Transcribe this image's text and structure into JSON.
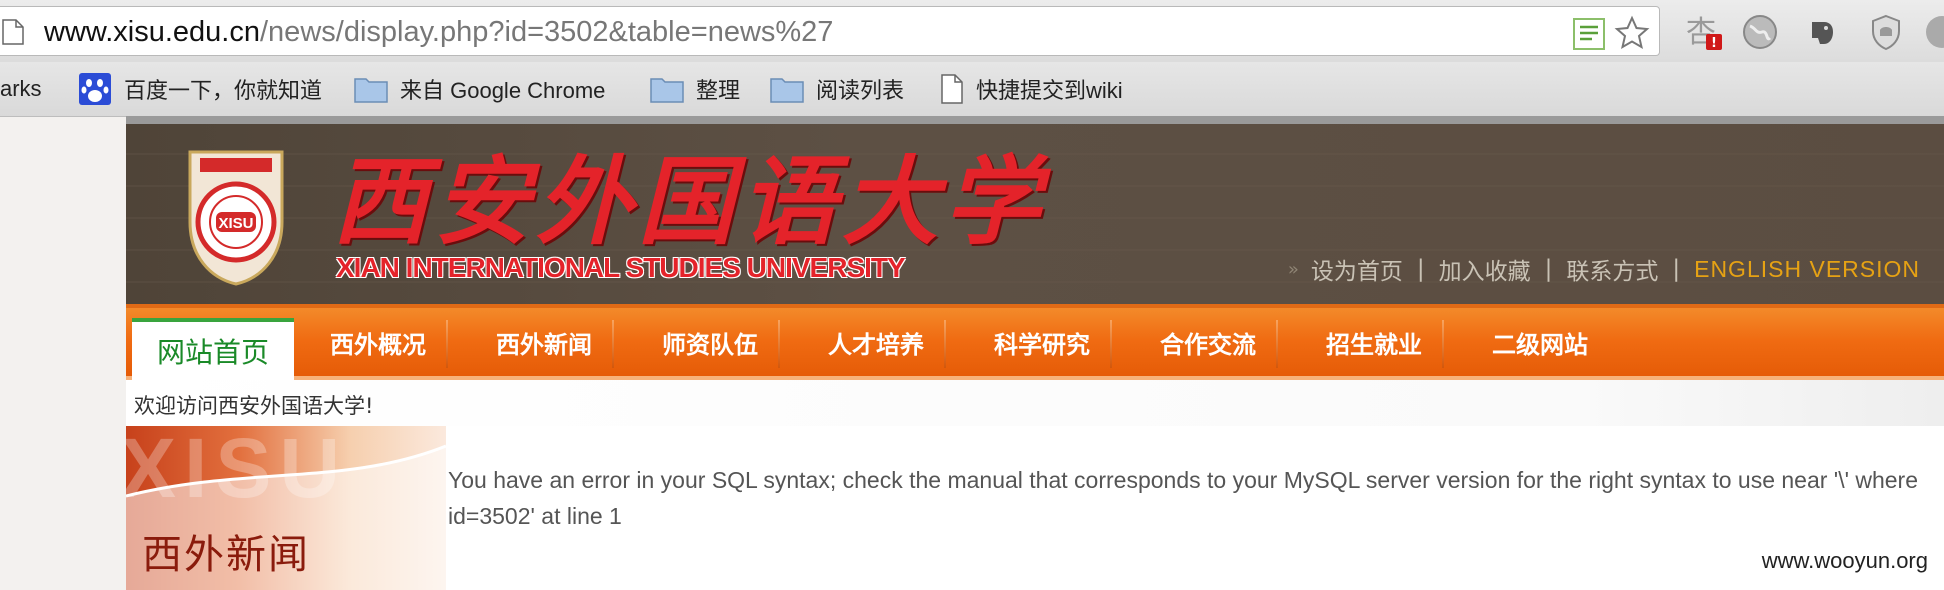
{
  "browser": {
    "url_host": "www.xisu.edu.cn",
    "url_path": "/news/display.php?id=3502&table=news%27",
    "extension_badge": "!",
    "bookmarks": [
      {
        "label": "arks",
        "icon": "none"
      },
      {
        "label": "百度一下，你就知道",
        "icon": "baidu-paw-icon"
      },
      {
        "label": "来自 Google Chrome",
        "icon": "folder-icon"
      },
      {
        "label": "整理",
        "icon": "folder-icon"
      },
      {
        "label": "阅读列表",
        "icon": "folder-icon"
      },
      {
        "label": "快捷提交到wiki",
        "icon": "page-icon"
      }
    ]
  },
  "site": {
    "logo_cn": "西安外国语大学",
    "logo_en": "XIAN INTERNATIONAL STUDIES UNIVERSITY",
    "seal_text": "XISU",
    "top_links": [
      "设为首页",
      "加入收藏",
      "联系方式"
    ],
    "english_version": "ENGLISH VERSION",
    "nav": {
      "home": "网站首页",
      "items": [
        "西外概况",
        "西外新闻",
        "师资队伍",
        "人才培养",
        "科学研究",
        "合作交流",
        "招生就业",
        "二级网站"
      ]
    },
    "welcome": "欢迎访问西安外国语大学!",
    "section_ghost": "XISU",
    "section_title": "西外新闻",
    "error_message": "You have an error in your SQL syntax; check the manual that corresponds to your MySQL server version for the right syntax to use near '\\' where id=3502' at line 1"
  },
  "watermark": "www.wooyun.org",
  "colors": {
    "banner_bg": "#574a3e",
    "nav_orange": "#f06b12",
    "logo_red": "#e4232a",
    "english_link": "#e6a214",
    "home_green": "#1a8a28"
  }
}
